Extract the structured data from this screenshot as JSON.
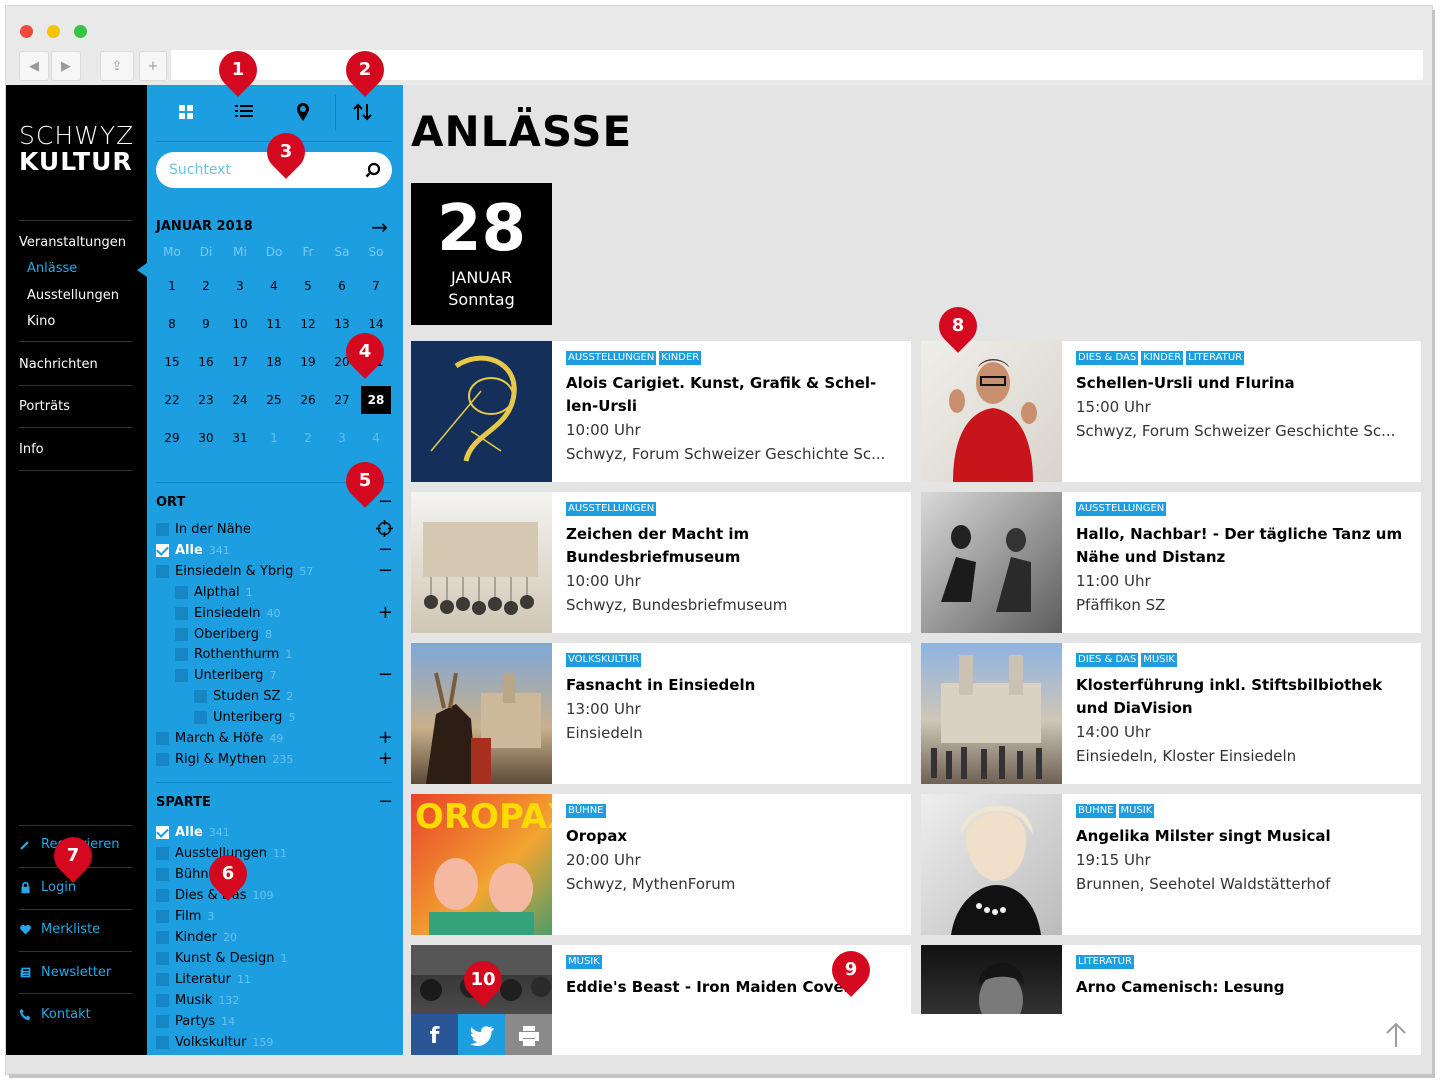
{
  "window": {
    "dot_colors": [
      "#ee4b3e",
      "#f3c300",
      "#35c444"
    ]
  },
  "nav_controls": {
    "back": "◀",
    "forward": "▶",
    "share": "⇪",
    "new_tab": "+"
  },
  "logo": {
    "line1": "SCHWYZ",
    "line2": "KULTUR"
  },
  "left_nav": {
    "items": [
      {
        "label": "Veranstaltungen"
      },
      {
        "label": "Nachrichten"
      },
      {
        "label": "Porträts"
      },
      {
        "label": "Info"
      }
    ],
    "sub_items": [
      {
        "label": "Anlässe"
      },
      {
        "label": "Ausstellungen"
      },
      {
        "label": "Kino"
      }
    ],
    "footer": [
      {
        "label": "Registrieren",
        "icon": "pencil-icon"
      },
      {
        "label": "Login",
        "icon": "lock-icon"
      },
      {
        "label": "Merkliste",
        "icon": "heart-icon"
      },
      {
        "label": "Newsletter",
        "icon": "newspaper-icon"
      },
      {
        "label": "Kontakt",
        "icon": "phone-icon"
      }
    ]
  },
  "toolbar": {
    "grid": "grid-view-icon",
    "list": "list-view-icon",
    "map": "map-pin-icon",
    "sort": "sort-icon"
  },
  "search": {
    "placeholder": "Suchtext",
    "value": ""
  },
  "calendar": {
    "month": "JANUAR 2018",
    "weekdays": [
      "Mo",
      "Di",
      "Mi",
      "Do",
      "Fr",
      "Sa",
      "So"
    ],
    "weeks": [
      [
        "1",
        "2",
        "3",
        "4",
        "5",
        "6",
        "7"
      ],
      [
        "8",
        "9",
        "10",
        "11",
        "12",
        "13",
        "14"
      ],
      [
        "15",
        "16",
        "17",
        "18",
        "19",
        "20",
        "21"
      ],
      [
        "22",
        "23",
        "24",
        "25",
        "26",
        "27",
        "28"
      ],
      [
        "29",
        "30",
        "31",
        "1",
        "2",
        "3",
        "4"
      ]
    ],
    "selected": "28"
  },
  "filters": {
    "ort": {
      "title": "ORT",
      "items": [
        {
          "label": "In der Nähe",
          "count": ""
        },
        {
          "label": "Alle",
          "count": "341"
        },
        {
          "label": "Einsiedeln & Ybrig",
          "count": "57"
        },
        {
          "label": "Alpthal",
          "count": "1"
        },
        {
          "label": "Einsiedeln",
          "count": "40"
        },
        {
          "label": "Oberiberg",
          "count": "8"
        },
        {
          "label": "Rothenthurm",
          "count": "1"
        },
        {
          "label": "Unteriberg",
          "count": "7"
        },
        {
          "label": "Studen SZ",
          "count": "2"
        },
        {
          "label": "Unteriberg",
          "count": "5"
        },
        {
          "label": "March & Höfe",
          "count": "49"
        },
        {
          "label": "Rigi & Mythen",
          "count": "235"
        }
      ]
    },
    "sparte": {
      "title": "SPARTE",
      "items": [
        {
          "label": "Alle",
          "count": "341"
        },
        {
          "label": "Ausstellungen",
          "count": "11"
        },
        {
          "label": "Bühne",
          "count": "33"
        },
        {
          "label": "Dies & Das",
          "count": "109"
        },
        {
          "label": "Film",
          "count": "3"
        },
        {
          "label": "Kinder",
          "count": "20"
        },
        {
          "label": "Kunst & Design",
          "count": "1"
        },
        {
          "label": "Literatur",
          "count": "11"
        },
        {
          "label": "Musik",
          "count": "132"
        },
        {
          "label": "Partys",
          "count": "14"
        },
        {
          "label": "Volkskultur",
          "count": "159"
        }
      ]
    }
  },
  "main": {
    "title": "ANLÄSSE",
    "date": {
      "day": "28",
      "month": "JANUAR",
      "weekday": "Sonntag"
    },
    "events": [
      {
        "tags": [
          "AUSSTELLUNGEN",
          "KINDER"
        ],
        "title": "Alois Carigiet. Kunst, Grafik & Schel-len-Ursli",
        "time": "10:00 Uhr",
        "place": "Schwyz, Forum Schweizer Geschichte Sc..."
      },
      {
        "tags": [
          "DIES & DAS",
          "KINDER",
          "LITERATUR"
        ],
        "title": "Schellen-Ursli und Flurina",
        "time": "15:00 Uhr",
        "place": "Schwyz, Forum Schweizer Geschichte Sc..."
      },
      {
        "tags": [
          "AUSSTELLUNGEN"
        ],
        "title": "Zeichen der Macht im Bundesbriefmuseum",
        "time": "10:00 Uhr",
        "place": "Schwyz, Bundesbriefmuseum"
      },
      {
        "tags": [
          "AUSSTELLUNGEN"
        ],
        "title": "Hallo, Nachbar! - Der tägliche Tanz um Nähe und Distanz",
        "time": "11:00 Uhr",
        "place": "Pfäffikon SZ"
      },
      {
        "tags": [
          "VOLKSKULTUR"
        ],
        "title": "Fasnacht in Einsiedeln",
        "time": "13:00 Uhr",
        "place": "Einsiedeln"
      },
      {
        "tags": [
          "DIES & DAS",
          "MUSIK"
        ],
        "title": "Klosterführung inkl. Stiftsbilbiothek und DiaVision",
        "time": "14:00 Uhr",
        "place": "Einsiedeln, Kloster Einsiedeln"
      },
      {
        "tags": [
          "BÜHNE"
        ],
        "title": "Oropax",
        "time": "20:00 Uhr",
        "place": "Schwyz, MythenForum"
      },
      {
        "tags": [
          "BÜHNE",
          "MUSIK"
        ],
        "title": "Angelika Milster singt Musical",
        "time": "19:15 Uhr",
        "place": "Brunnen, Seehotel Waldstätterhof"
      },
      {
        "tags": [
          "MUSIK"
        ],
        "title": "Eddie's Beast - Iron Maiden Cover",
        "time": "",
        "place": ""
      },
      {
        "tags": [
          "LITERATUR"
        ],
        "title": "Arno Camenisch: Lesung",
        "time": "",
        "place": ""
      }
    ]
  },
  "share": {
    "facebook": "f",
    "twitter": "twitter-icon",
    "print": "print-icon",
    "top": "arrow-up-icon"
  },
  "callouts": [
    "1",
    "2",
    "3",
    "4",
    "5",
    "6",
    "7",
    "8",
    "9",
    "10"
  ],
  "colors": {
    "accent": "#1d9ee0",
    "badge": "#d4081f",
    "sidebar": "#000000"
  }
}
